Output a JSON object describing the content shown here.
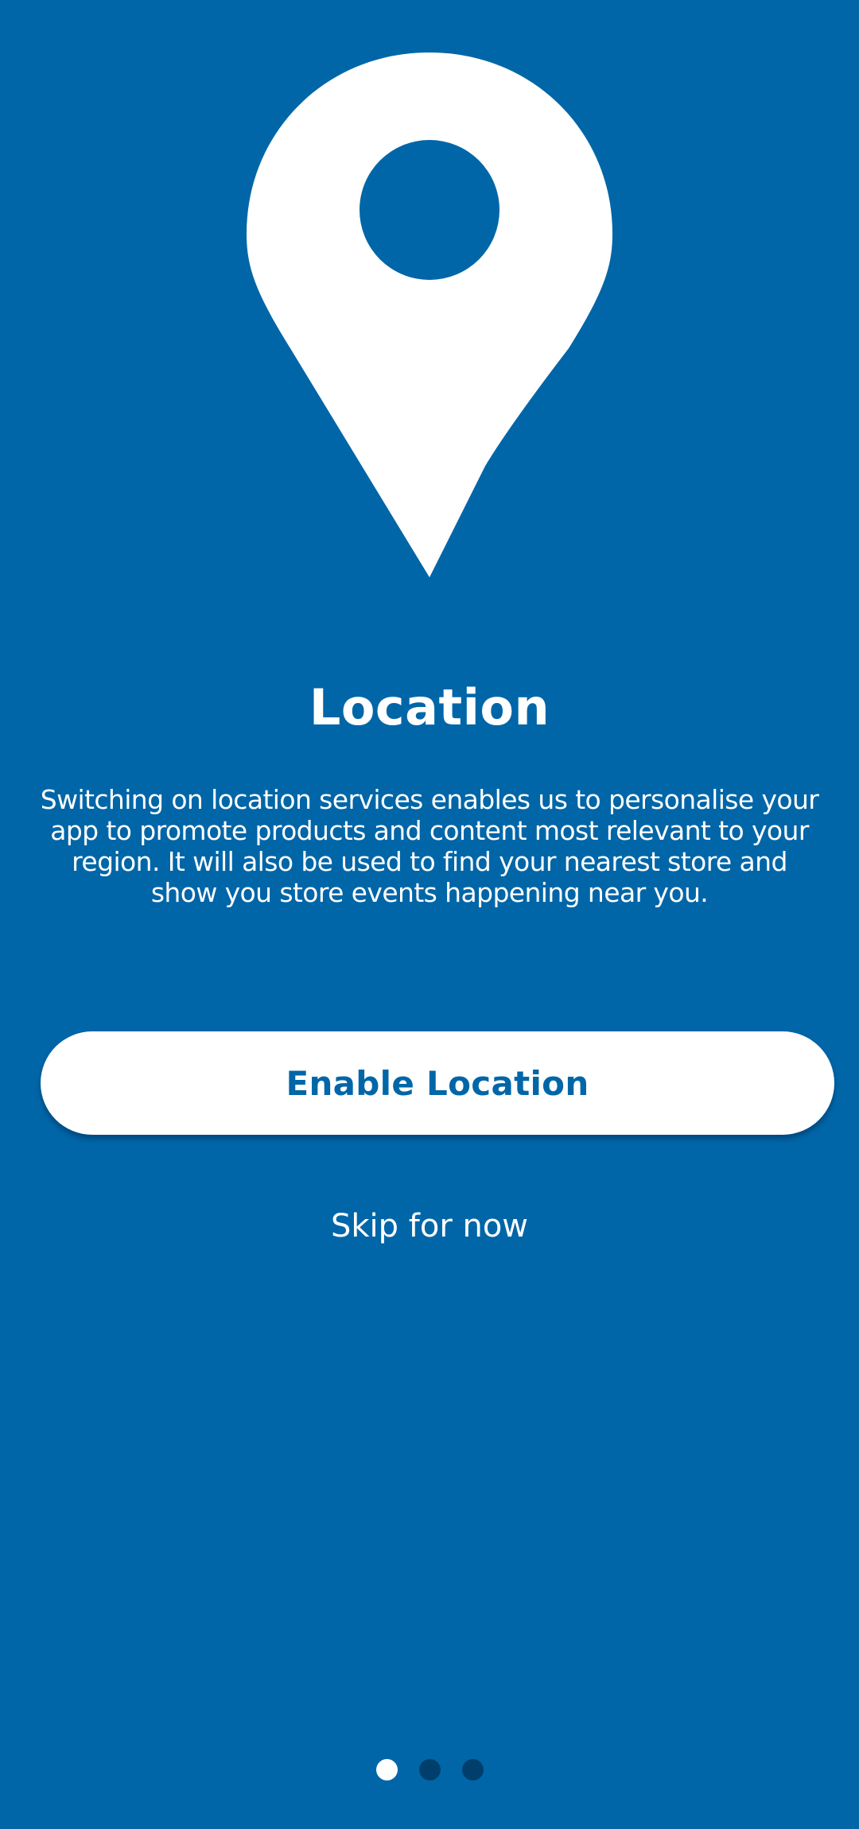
{
  "colors": {
    "background": "#0066A8",
    "foreground": "#FFFFFF",
    "button_text": "#0066A8",
    "inactive_dot": "#003F6B"
  },
  "hero": {
    "icon": "location-pin-icon"
  },
  "title": "Location",
  "description": "Switching on location services enables us to personalise your app to promote products and content most relevant to your region. It will also be used to find your nearest store and show you store events happening near you.",
  "actions": {
    "enable_label": "Enable Location",
    "skip_label": "Skip for now"
  },
  "pagination": {
    "total": 3,
    "current": 1
  }
}
